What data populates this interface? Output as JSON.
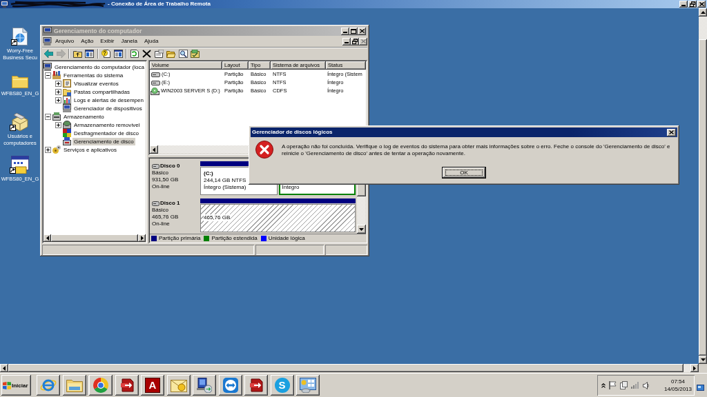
{
  "remote_window": {
    "title": "- Conexão de Área de Trabalho Remota"
  },
  "desktop_icons": [
    {
      "label": "Worry-Free Business Secu",
      "kind": "web-page",
      "shortcut": true
    },
    {
      "label": "WFBS80_EN_G",
      "kind": "folder",
      "shortcut": false
    },
    {
      "label": "Usuários e computadores",
      "kind": "package",
      "shortcut": true
    },
    {
      "label": "WFBS80_EN_G",
      "kind": "setup",
      "shortcut": true
    }
  ],
  "computer_management": {
    "title": "Gerenciamento do computador",
    "menu": [
      "Arquivo",
      "Ação",
      "Exibir",
      "Janela",
      "Ajuda"
    ],
    "toolbar": [
      [
        {
          "kind": "back",
          "disabled": false
        },
        {
          "kind": "forward",
          "disabled": true
        }
      ],
      [
        {
          "kind": "folder-up",
          "disabled": false
        },
        {
          "kind": "tree-pane",
          "disabled": false
        }
      ],
      [
        {
          "kind": "help",
          "disabled": false
        },
        {
          "kind": "pane",
          "disabled": false
        }
      ],
      [
        {
          "kind": "refresh",
          "disabled": false
        },
        {
          "kind": "delete",
          "disabled": false
        },
        {
          "kind": "properties",
          "disabled": false
        },
        {
          "kind": "open-folder",
          "disabled": false
        },
        {
          "kind": "search",
          "disabled": false
        },
        {
          "kind": "checklist",
          "disabled": false
        }
      ]
    ],
    "tree": [
      {
        "label": "Gerenciamento do computador (loca",
        "kind": "computer",
        "selected": false,
        "children": [
          {
            "label": "Ferramentas do sistema",
            "kind": "tools",
            "selected": false,
            "expanded": true,
            "children": [
              {
                "label": "Visualizar eventos",
                "kind": "event-log",
                "selected": false,
                "expanded": false
              },
              {
                "label": "Pastas compartilhadas",
                "kind": "shared-folder",
                "selected": false,
                "expanded": false
              },
              {
                "label": "Logs e alertas de desempen",
                "kind": "chart",
                "selected": false,
                "expanded": false
              },
              {
                "label": "Gerenciador de dispositivos",
                "kind": "device",
                "selected": false
              }
            ]
          },
          {
            "label": "Armazenamento",
            "kind": "storage",
            "selected": false,
            "expanded": true,
            "children": [
              {
                "label": "Armazenamento removível",
                "kind": "removable",
                "selected": false,
                "expanded": false
              },
              {
                "label": "Desfragmentador de disco",
                "kind": "defrag",
                "selected": false
              },
              {
                "label": "Gerenciamento de disco",
                "kind": "disk-management",
                "selected": true
              }
            ]
          },
          {
            "label": "Serviços e aplicativos",
            "kind": "services",
            "selected": false,
            "expanded": false
          }
        ]
      }
    ],
    "volumes": {
      "columns": [
        "Volume",
        "Layout",
        "Tipo",
        "Sistema de arquivos",
        "Status"
      ],
      "rows": [
        {
          "kind": "disk",
          "cells": [
            "(C:)",
            "Partição",
            "Básico",
            "NTFS",
            "Íntegro (Sistem"
          ]
        },
        {
          "kind": "disk",
          "cells": [
            "(E:)",
            "Partição",
            "Básico",
            "NTFS",
            "Íntegro"
          ]
        },
        {
          "kind": "cd",
          "cells": [
            "WIN2003 SERVER S (D:)",
            "Partição",
            "Básico",
            "CDFS",
            "Íntegro"
          ]
        }
      ]
    },
    "disks": [
      {
        "name": "Disco 0",
        "type": "Básico",
        "size": "931,50 GB",
        "status": "On-line",
        "partitions": [
          {
            "kind": "primary",
            "selected": false,
            "label": "(C:)",
            "size": "244,14 GB NTFS",
            "status": "Íntegro (Sistema)"
          },
          {
            "kind": "extended",
            "selected": false,
            "status": "Íntegro"
          }
        ]
      },
      {
        "name": "Disco 1",
        "type": "Básico",
        "size": "465,76 GB",
        "status": "On-line",
        "partitions": [
          {
            "kind": "primary",
            "selected": true,
            "size": "465,76 GB"
          }
        ]
      }
    ],
    "legend": [
      {
        "label": "Partição primária",
        "color": "#000080"
      },
      {
        "label": "Partição estendida",
        "color": "#008000"
      },
      {
        "label": "Unidade lógica",
        "color": "#0000ff"
      }
    ]
  },
  "dialog": {
    "title": "Gerenciador de discos lógicos",
    "message": "A operação não foi concluída. Verifique o log de eventos do sistema para obter mais informações sobre o erro. Feche o console do 'Gerenciamento de disco' e reinicie o 'Gerenciamento de disco' antes de tentar a operação novamente.",
    "buttons": [
      "OK"
    ]
  },
  "taskbar": {
    "start": "Iniciar",
    "quick_launch": [
      {
        "kind": "browser-e"
      },
      {
        "kind": "folder"
      }
    ],
    "apps": [
      {
        "kind": "color-wheel"
      },
      {
        "kind": "database"
      },
      {
        "kind": "letter-tile",
        "glyph": "A"
      },
      {
        "kind": "mail"
      },
      {
        "kind": "network"
      },
      {
        "kind": "arrows-tile"
      },
      {
        "kind": "database"
      },
      {
        "kind": "letter-disc",
        "glyph": "S"
      },
      {
        "kind": "control-panel"
      }
    ],
    "tray": {
      "time": "07:54",
      "date": "14/05/2013"
    }
  }
}
